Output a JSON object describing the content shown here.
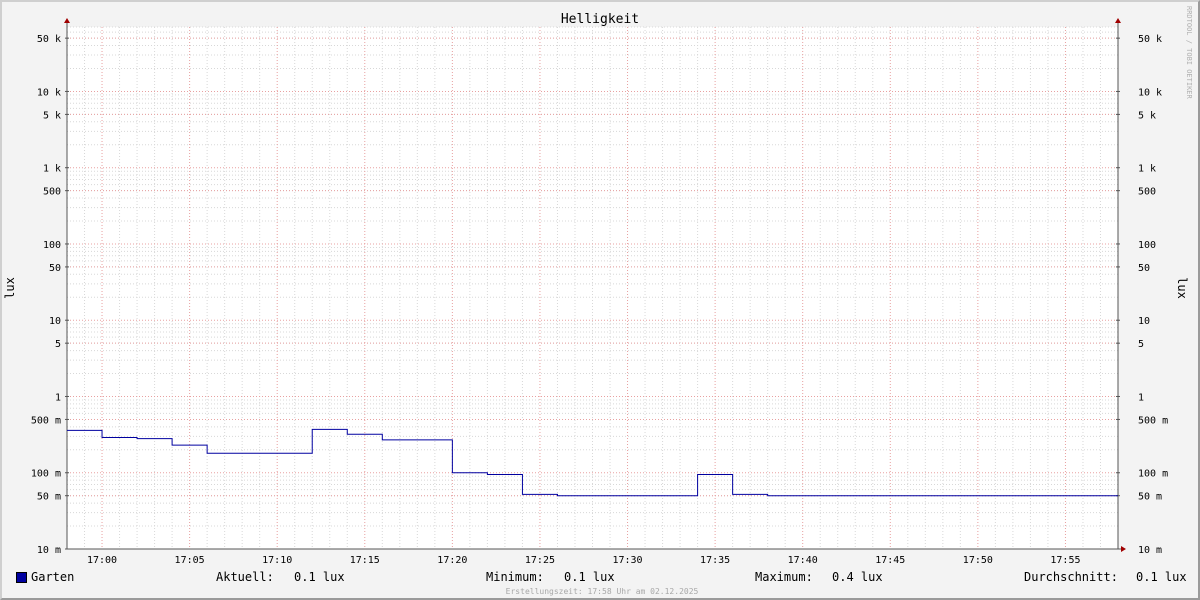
{
  "chart_data": {
    "type": "line",
    "title": "Helligkeit",
    "ylabel_left": "lux",
    "ylabel_right": "lux",
    "y_scale": "log",
    "ylim": [
      10,
      70000
    ],
    "y_unit": "lux",
    "y_ticks": [
      {
        "value": 50000,
        "label": "50 k"
      },
      {
        "value": 10000,
        "label": "10 k"
      },
      {
        "value": 5000,
        "label": "5 k"
      },
      {
        "value": 1000,
        "label": "1 k"
      },
      {
        "value": 500,
        "label": "500"
      },
      {
        "value": 100,
        "label": "100"
      },
      {
        "value": 50,
        "label": "50"
      },
      {
        "value": 10,
        "label": "10"
      },
      {
        "value": 5,
        "label": "5"
      },
      {
        "value": 1,
        "label": "1"
      },
      {
        "value": 0.5,
        "label": "500 m"
      },
      {
        "value": 0.1,
        "label": "100 m"
      },
      {
        "value": 0.05,
        "label": "50 m"
      },
      {
        "value": 0.01,
        "label": "10 m"
      }
    ],
    "x_ticks": [
      "17:00",
      "17:05",
      "17:10",
      "17:15",
      "17:20",
      "17:25",
      "17:30",
      "17:35",
      "17:40",
      "17:45",
      "17:50",
      "17:55"
    ],
    "xlim": [
      "16:58",
      "17:58"
    ],
    "grid": true,
    "series": [
      {
        "name": "Garten",
        "color": "#0000a0",
        "step": true,
        "points": [
          {
            "t": "16:58",
            "v": 0.36
          },
          {
            "t": "17:00",
            "v": 0.29
          },
          {
            "t": "17:02",
            "v": 0.28
          },
          {
            "t": "17:04",
            "v": 0.23
          },
          {
            "t": "17:06",
            "v": 0.18
          },
          {
            "t": "17:12",
            "v": 0.37
          },
          {
            "t": "17:14",
            "v": 0.32
          },
          {
            "t": "17:16",
            "v": 0.27
          },
          {
            "t": "17:20",
            "v": 0.1
          },
          {
            "t": "17:22",
            "v": 0.095
          },
          {
            "t": "17:24",
            "v": 0.052
          },
          {
            "t": "17:26",
            "v": 0.05
          },
          {
            "t": "17:34",
            "v": 0.095
          },
          {
            "t": "17:36",
            "v": 0.052
          },
          {
            "t": "17:38",
            "v": 0.05
          },
          {
            "t": "17:58",
            "v": 0.05
          }
        ]
      }
    ]
  },
  "legend": {
    "series_name": "Garten",
    "current_label": "Aktuell:",
    "current_value": "0.1 lux",
    "min_label": "Minimum:",
    "min_value": "0.1 lux",
    "max_label": "Maximum:",
    "max_value": "0.4 lux",
    "avg_label": "Durchschnitt:",
    "avg_value": "0.1 lux"
  },
  "watermark": "RRDTOOL / TOBI OETIKER",
  "created": "Erstellungszeit: 17:58 Uhr am 02.12.2025"
}
